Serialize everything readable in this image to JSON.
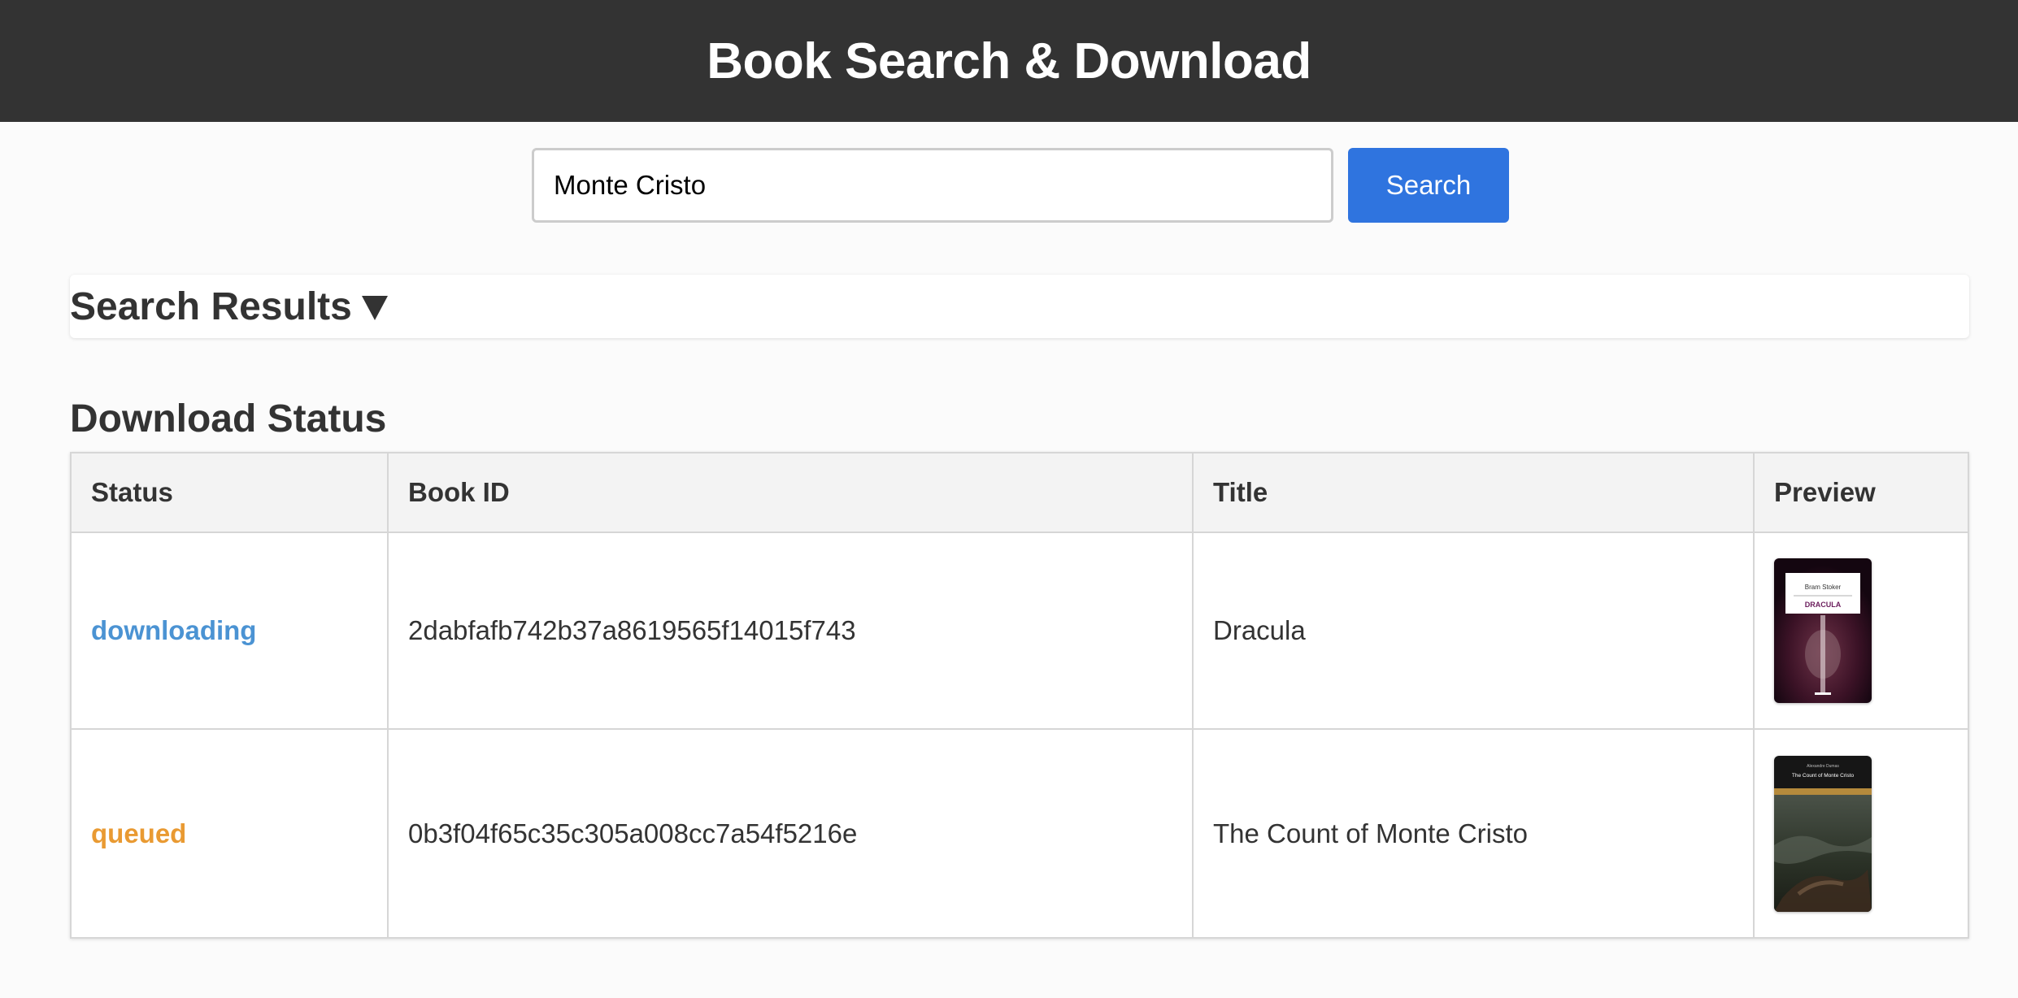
{
  "header": {
    "title": "Book Search & Download"
  },
  "search": {
    "value": "Monte Cristo",
    "button_label": "Search"
  },
  "results": {
    "heading": "Search Results ",
    "expanded": true
  },
  "downloads": {
    "heading": "Download Status",
    "columns": [
      "Status",
      "Book ID",
      "Title",
      "Preview"
    ],
    "rows": [
      {
        "status": "downloading",
        "book_id": "2dabfafb742b37a8619565f14015f743",
        "title": "Dracula",
        "cover": {
          "author": "Bram Stoker",
          "title": "DRACULA"
        }
      },
      {
        "status": "queued",
        "book_id": "0b3f04f65c35c305a008cc7a54f5216e",
        "title": "The Count of Monte Cristo",
        "cover": {
          "author": "Alexandre Dumas",
          "title": "The Count of Monte Cristo"
        }
      }
    ]
  },
  "colors": {
    "header_bg": "#333333",
    "button_bg": "#2f74df",
    "status_downloading": "#4b93d3",
    "status_queued": "#e99a32"
  }
}
